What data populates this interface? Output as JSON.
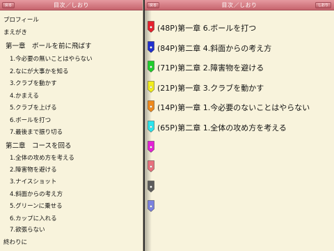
{
  "left": {
    "nav": {
      "back_label": "戻る",
      "title": "目次／しおり"
    },
    "toc": [
      {
        "label": "プロフィール",
        "kind": "top"
      },
      {
        "label": "まえがき",
        "kind": "top"
      },
      {
        "label": "第一章　ボールを前に飛ばす",
        "kind": "chapter"
      },
      {
        "label": "1.今必要の無いことはやらない",
        "kind": "section"
      },
      {
        "label": "2.なにが大事かを知る",
        "kind": "section"
      },
      {
        "label": "3.クラブを動かす",
        "kind": "section"
      },
      {
        "label": "4.かまえる",
        "kind": "section"
      },
      {
        "label": "5.クラブを上げる",
        "kind": "section"
      },
      {
        "label": "6.ボールを打つ",
        "kind": "section"
      },
      {
        "label": "7.最後まで振り切る",
        "kind": "section"
      },
      {
        "label": "第二章　コースを回る",
        "kind": "chapter"
      },
      {
        "label": "1.全体の攻め方を考える",
        "kind": "section"
      },
      {
        "label": "2.障害物を避ける",
        "kind": "section"
      },
      {
        "label": "3.ナイスショット",
        "kind": "section"
      },
      {
        "label": "4.斜面からの考え方",
        "kind": "section"
      },
      {
        "label": "5.グリーンに乗せる",
        "kind": "section"
      },
      {
        "label": "6.カップに入れる",
        "kind": "section"
      },
      {
        "label": "7.欲張らない",
        "kind": "section"
      },
      {
        "label": "終わりに",
        "kind": "top"
      }
    ]
  },
  "right": {
    "nav": {
      "back_label": "戻る",
      "title": "目次／しおり",
      "shiori_label": "しおり"
    },
    "bookmarks": [
      {
        "label": "(48P)第一章 6.ボールを打つ",
        "color": "#e8202c"
      },
      {
        "label": "(84P)第二章 4.斜面からの考え方",
        "color": "#1f2fd0"
      },
      {
        "label": "(71P)第二章 2.障害物を避ける",
        "color": "#1fcf2b"
      },
      {
        "label": "(21P)第一章 3.クラブを動かす",
        "color": "#f2ee1c"
      },
      {
        "label": "(14P)第一章 1.今必要のないことはやらない",
        "color": "#f08a1c"
      },
      {
        "label": "(65P)第二章 1.全体の攻め方を考える",
        "color": "#2ae6ee"
      },
      {
        "label": "",
        "color": "#e620d8"
      },
      {
        "label": "",
        "color": "#e8707e"
      },
      {
        "label": "",
        "color": "#5c5c5c"
      },
      {
        "label": "",
        "color": "#7b82e0"
      }
    ]
  }
}
